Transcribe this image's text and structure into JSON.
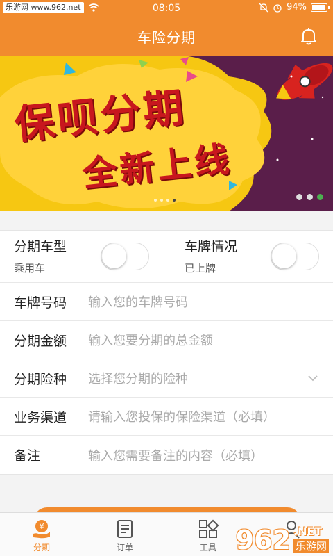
{
  "status_bar": {
    "watermark": "乐游网 www.962.net",
    "time": "08:05",
    "battery": "94%",
    "icons": [
      "wifi-icon",
      "mute-icon",
      "alarm-icon",
      "battery-icon"
    ]
  },
  "header": {
    "title": "车险分期",
    "right_icon": "bell-icon"
  },
  "banner": {
    "line1": "保呗分期",
    "line2": "全新上线",
    "dots_center": 4,
    "dots_center_active": 3,
    "dots_right": 3,
    "dots_right_active": 2
  },
  "form": {
    "toggles": [
      {
        "label": "分期车型",
        "value": "乘用车"
      },
      {
        "label": "车牌情况",
        "value": "已上牌"
      }
    ],
    "fields": [
      {
        "label": "车牌号码",
        "placeholder": "输入您的车牌号码"
      },
      {
        "label": "分期金额",
        "placeholder": "输入您要分期的总金额"
      },
      {
        "label": "分期险种",
        "placeholder": "选择您分期的险种"
      },
      {
        "label": "业务渠道",
        "placeholder": "请输入您投保的保险渠道（必填）"
      },
      {
        "label": "备注",
        "placeholder": "输入您需要备注的内容（必填）"
      }
    ]
  },
  "tabs": [
    {
      "label": "分期",
      "icon": "installment-icon",
      "active": true
    },
    {
      "label": "订单",
      "icon": "order-icon",
      "active": false
    },
    {
      "label": "工具",
      "icon": "tools-icon",
      "active": false
    },
    {
      "label": "",
      "icon": "profile-icon",
      "active": false
    }
  ],
  "watermark": {
    "num": "962",
    "net": ".NET",
    "cn": "乐游网"
  },
  "colors": {
    "primary": "#f18b2e",
    "banner_bg": "#f6c712",
    "banner_purple": "#5a1e4a",
    "banner_text": "#c8171e"
  }
}
